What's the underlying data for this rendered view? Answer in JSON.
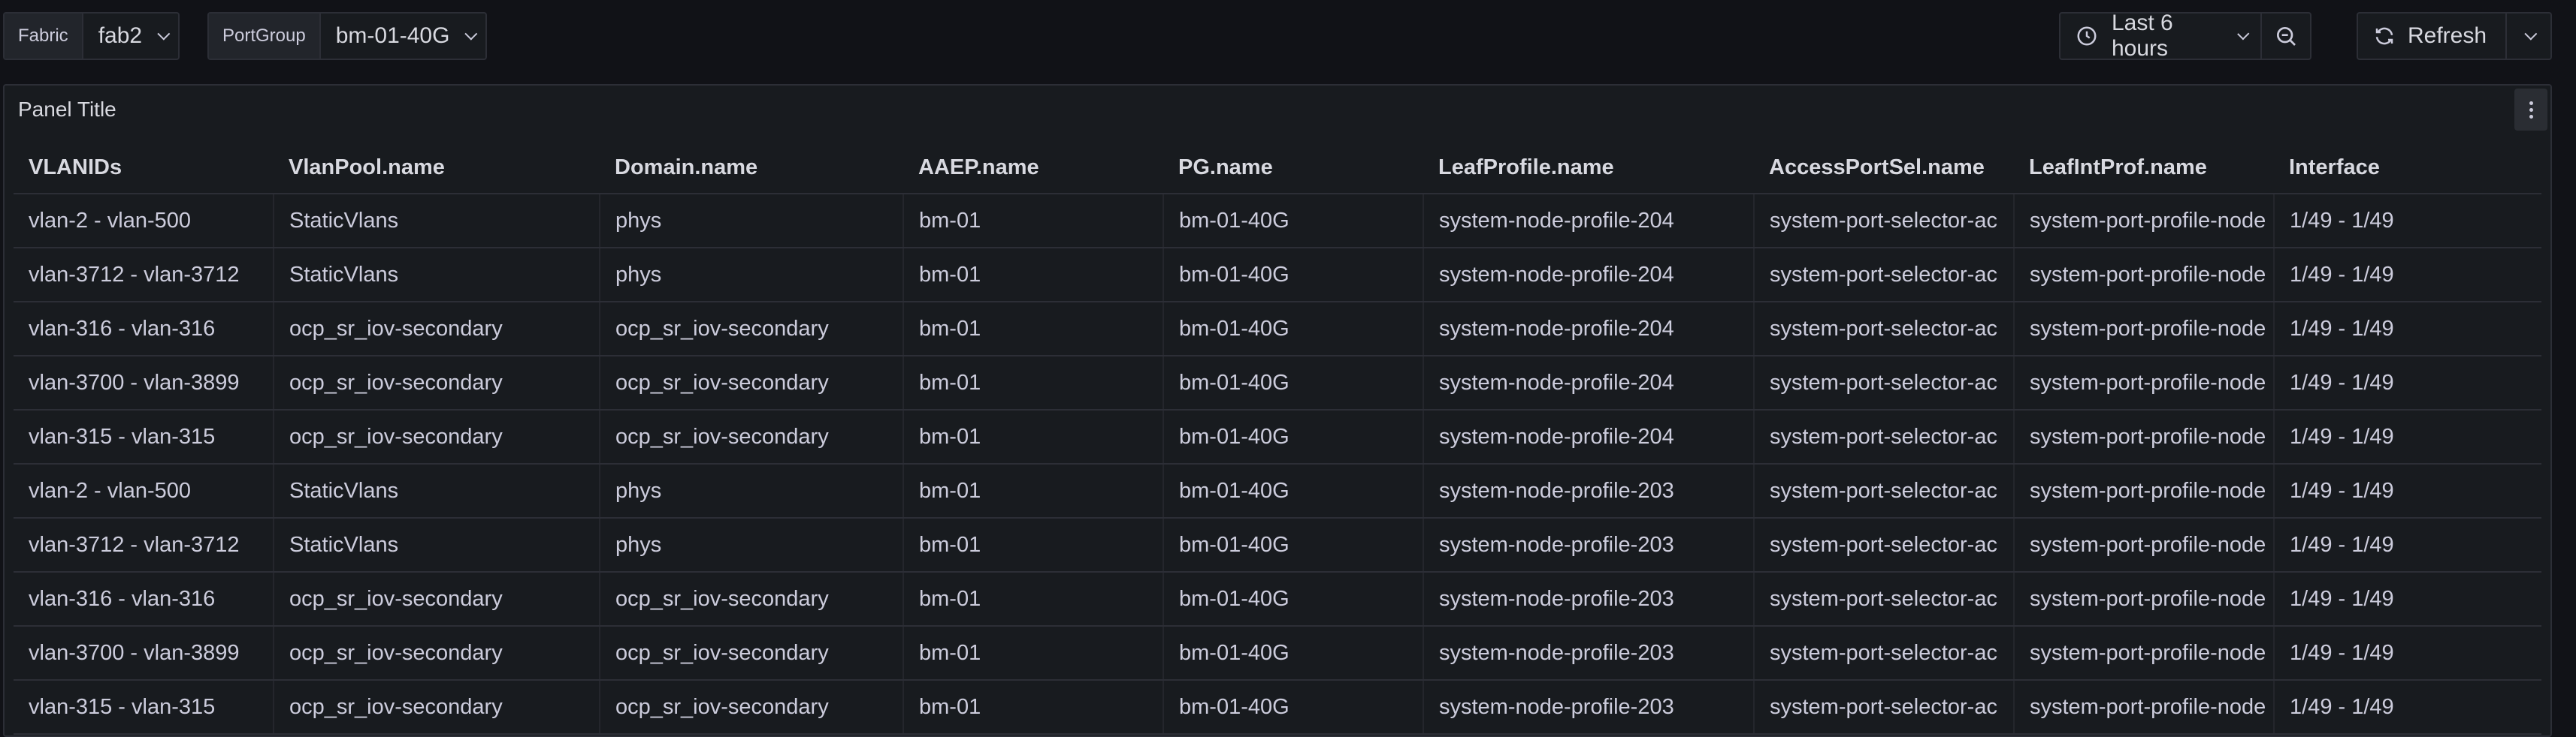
{
  "variables": [
    {
      "label": "Fabric",
      "value": "fab2"
    },
    {
      "label": "PortGroup",
      "value": "bm-01-40G"
    }
  ],
  "toolbar": {
    "time_range": "Last 6 hours",
    "refresh_label": "Refresh"
  },
  "icons": {
    "time": "clock-icon",
    "zoom_out": "zoom-out-icon",
    "refresh": "refresh-icon"
  },
  "panel": {
    "title": "Panel Title",
    "table": {
      "columns": [
        "VLANIDs",
        "VlanPool.name",
        "Domain.name",
        "AAEP.name",
        "PG.name",
        "LeafProfile.name",
        "AccessPortSel.name",
        "LeafIntProf.name",
        "Interface"
      ],
      "rows": [
        [
          "vlan-2 - vlan-500",
          "StaticVlans",
          "phys",
          "bm-01",
          "bm-01-40G",
          "system-node-profile-204",
          "system-port-selector-ac",
          "system-port-profile-node",
          "1/49 - 1/49"
        ],
        [
          "vlan-3712 - vlan-3712",
          "StaticVlans",
          "phys",
          "bm-01",
          "bm-01-40G",
          "system-node-profile-204",
          "system-port-selector-ac",
          "system-port-profile-node",
          "1/49 - 1/49"
        ],
        [
          "vlan-316 - vlan-316",
          "ocp_sr_iov-secondary",
          "ocp_sr_iov-secondary",
          "bm-01",
          "bm-01-40G",
          "system-node-profile-204",
          "system-port-selector-ac",
          "system-port-profile-node",
          "1/49 - 1/49"
        ],
        [
          "vlan-3700 - vlan-3899",
          "ocp_sr_iov-secondary",
          "ocp_sr_iov-secondary",
          "bm-01",
          "bm-01-40G",
          "system-node-profile-204",
          "system-port-selector-ac",
          "system-port-profile-node",
          "1/49 - 1/49"
        ],
        [
          "vlan-315 - vlan-315",
          "ocp_sr_iov-secondary",
          "ocp_sr_iov-secondary",
          "bm-01",
          "bm-01-40G",
          "system-node-profile-204",
          "system-port-selector-ac",
          "system-port-profile-node",
          "1/49 - 1/49"
        ],
        [
          "vlan-2 - vlan-500",
          "StaticVlans",
          "phys",
          "bm-01",
          "bm-01-40G",
          "system-node-profile-203",
          "system-port-selector-ac",
          "system-port-profile-node",
          "1/49 - 1/49"
        ],
        [
          "vlan-3712 - vlan-3712",
          "StaticVlans",
          "phys",
          "bm-01",
          "bm-01-40G",
          "system-node-profile-203",
          "system-port-selector-ac",
          "system-port-profile-node",
          "1/49 - 1/49"
        ],
        [
          "vlan-316 - vlan-316",
          "ocp_sr_iov-secondary",
          "ocp_sr_iov-secondary",
          "bm-01",
          "bm-01-40G",
          "system-node-profile-203",
          "system-port-selector-ac",
          "system-port-profile-node",
          "1/49 - 1/49"
        ],
        [
          "vlan-3700 - vlan-3899",
          "ocp_sr_iov-secondary",
          "ocp_sr_iov-secondary",
          "bm-01",
          "bm-01-40G",
          "system-node-profile-203",
          "system-port-selector-ac",
          "system-port-profile-node",
          "1/49 - 1/49"
        ],
        [
          "vlan-315 - vlan-315",
          "ocp_sr_iov-secondary",
          "ocp_sr_iov-secondary",
          "bm-01",
          "bm-01-40G",
          "system-node-profile-203",
          "system-port-selector-ac",
          "system-port-profile-node",
          "1/49 - 1/49"
        ]
      ]
    }
  }
}
